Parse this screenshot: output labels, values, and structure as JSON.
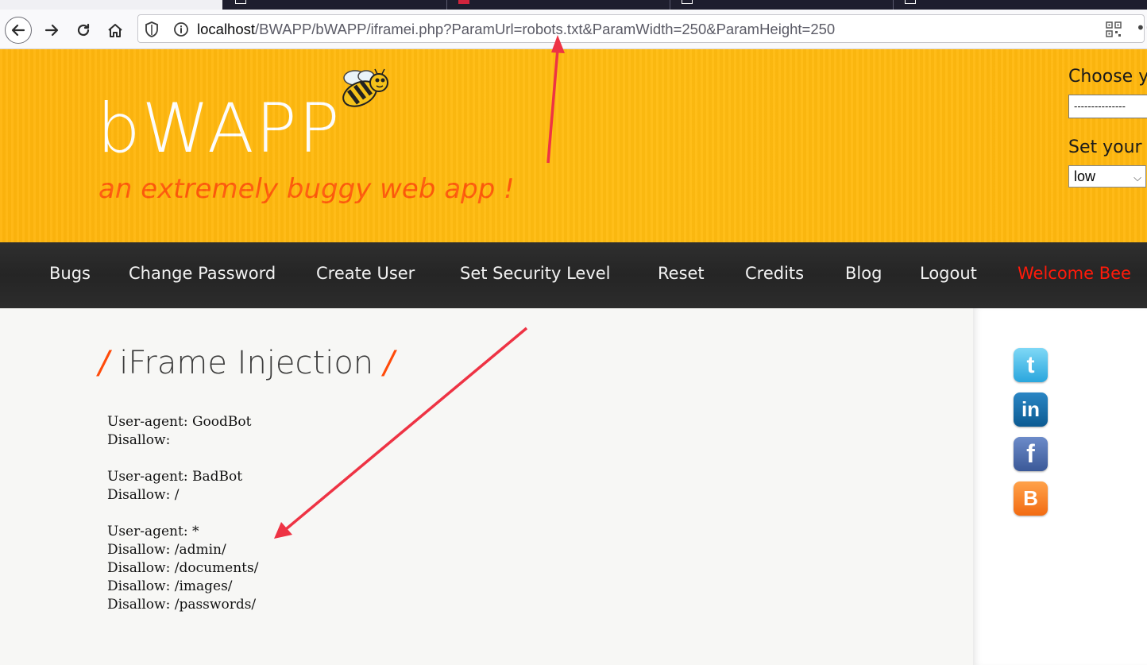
{
  "browser": {
    "url_host": "localhost",
    "url_rest": "/BWAPP/bWAPP/iframei.php?ParamUrl=robots.txt&ParamWidth=250&ParamHeight=250"
  },
  "header": {
    "logo": "bWAPP",
    "tagline": "an extremely buggy web app !",
    "choose_bug_label": "Choose y",
    "bug_select_value": "---------------",
    "security_label": "Set your",
    "security_level": "low"
  },
  "menu": {
    "items": [
      "Bugs",
      "Change Password",
      "Create User",
      "Set Security Level",
      "Reset",
      "Credits",
      "Blog",
      "Logout"
    ],
    "welcome": "Welcome Bee"
  },
  "main": {
    "title": "iFrame Injection",
    "iframe_content": "User-agent: GoodBot\nDisallow:\n\nUser-agent: BadBot\nDisallow: /\n\nUser-agent: *\nDisallow: /admin/\nDisallow: /documents/\nDisallow: /images/\nDisallow: /passwords/"
  },
  "social": {
    "twitter_icon": "t",
    "linkedin_icon": "in",
    "facebook_icon": "f",
    "blogger_icon": "B"
  },
  "colors": {
    "header_bg": "#ffb70e",
    "tagline": "#ff5a0a",
    "menu_bg": "#2a2a2a",
    "welcome": "#ff1a0a",
    "annotation_arrow": "#ee3344"
  }
}
